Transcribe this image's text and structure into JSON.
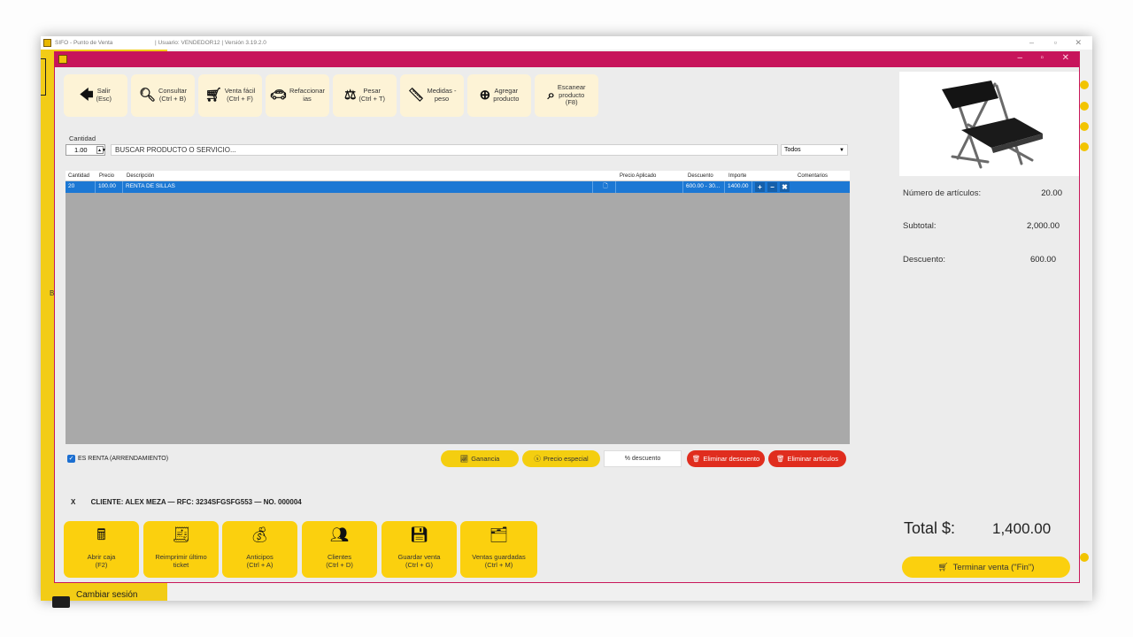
{
  "window": {
    "app_title": "SIFO - Punto de Venta",
    "user_info": "| Usuario: VENDEDOR12 | Versión 3.19.2.0",
    "minimize": "–",
    "maximize": "▫",
    "close": "✕"
  },
  "sidebar": {
    "partial_letter": "B",
    "cambiar_sesion": "Cambiar sesión"
  },
  "toolbar": [
    {
      "label": "Salir\n(Esc)",
      "icon": "back-arrow-icon"
    },
    {
      "label": "Consultar\n(Ctrl + B)",
      "icon": "search-icon"
    },
    {
      "label": "Venta fácil\n(Ctrl + F)",
      "icon": "cart-icon"
    },
    {
      "label": "Refaccionar\nias",
      "icon": "car-icon"
    },
    {
      "label": "Pesar\n(Ctrl + T)",
      "icon": "scale-icon"
    },
    {
      "label": "Medidas -\npeso",
      "icon": "ruler-icon"
    },
    {
      "label": "Agregar\nproducto",
      "icon": "plus-circle-icon"
    },
    {
      "label": "Escanear\nproducto\n(F8)",
      "icon": "scan-icon"
    }
  ],
  "search": {
    "cantidad_label": "Cantidad",
    "cantidad_value": "1.00",
    "placeholder": "BUSCAR PRODUCTO O SERVICIO...",
    "filter_value": "Todos"
  },
  "grid": {
    "columns": [
      "Cantidad",
      "Precio",
      "Descripción",
      "Precio Aplicado",
      "Descuento",
      "Importe",
      "Comentarios"
    ],
    "rows": [
      {
        "cantidad": "20",
        "precio": "100.00",
        "descripcion": "RENTA DE SILLAS",
        "precio_aplicado": "",
        "descuento": "600.00 - 30...",
        "importe": "1400.00",
        "comentarios": ""
      }
    ],
    "row_actions": [
      "+",
      "−",
      "✖"
    ]
  },
  "actions": {
    "renta_label": "ES RENTA (ARRENDAMIENTO)",
    "ganancia": "Ganancia",
    "precio_especial": "Precio especial",
    "pct_descuento": "% descuento",
    "eliminar_descuento": "Eliminar descuento",
    "eliminar_articulos": "Eliminar artículos"
  },
  "cliente": {
    "close": "X",
    "text": "CLIENTE: ALEX MEZA — RFC: 3234SFGSFG553 — NO. 000004"
  },
  "footer_buttons": [
    {
      "label": "Abrir caja\n(F2)",
      "icon": "cash-register-icon"
    },
    {
      "label": "Reimprimir último\nticket",
      "icon": "receipt-icon"
    },
    {
      "label": "Anticipos\n(Ctrl + A)",
      "icon": "money-bag-icon"
    },
    {
      "label": "Clientes\n(Ctrl + D)",
      "icon": "users-icon"
    },
    {
      "label": "Guardar venta\n(Ctrl + G)",
      "icon": "save-icon"
    },
    {
      "label": "Ventas guardadas\n(Ctrl + M)",
      "icon": "saved-sales-icon"
    }
  ],
  "summary": {
    "articulos_label": "Número de artículos:",
    "articulos_value": "20.00",
    "subtotal_label": "Subtotal:",
    "subtotal_value": "2,000.00",
    "descuento_label": "Descuento:",
    "descuento_value": "600.00",
    "total_label": "Total $:",
    "total_value": "1,400.00",
    "terminar": "Terminar venta (\"Fin\")"
  },
  "colors": {
    "accent": "#c7145b",
    "yellow": "#fbd00e",
    "selection": "#1c78d4",
    "danger": "#e02d1e"
  }
}
